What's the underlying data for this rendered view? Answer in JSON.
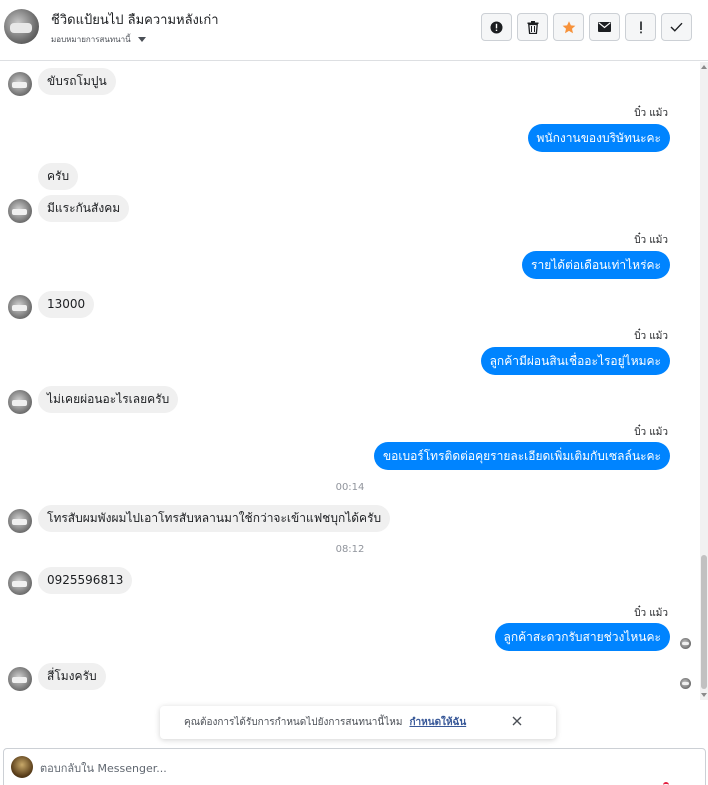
{
  "header": {
    "title": "ชีวิดแป้ยนไป ลืมความหลังเก่า",
    "subtitle": "มอบหมายการสนทนานี้"
  },
  "toolbar": {
    "icons": [
      "alert-circle-icon",
      "trash-icon",
      "star-icon",
      "envelope-icon",
      "exclamation-icon",
      "checkmark-icon"
    ],
    "star_color": "#f7923b"
  },
  "thread": {
    "sender_name": "บิ๋ว แม้ว",
    "messages": [
      {
        "dir": "in",
        "text": "ขับรถโมปูน"
      },
      {
        "dir": "out",
        "text": "พนักงานของบริษัทนะคะ"
      },
      {
        "dir": "in",
        "text": "ครับ"
      },
      {
        "dir": "in",
        "text": "มีแระกันสังคม"
      },
      {
        "dir": "out",
        "text": "รายได้ต่อเดือนเท่าไหร่คะ"
      },
      {
        "dir": "in",
        "text": "13000"
      },
      {
        "dir": "out",
        "text": "ลูกค้ามีผ่อนสินเชื่ออะไรอยู่ไหมคะ"
      },
      {
        "dir": "in",
        "text": "ไม่เคยผ่อนอะไรเลยครับ"
      },
      {
        "dir": "out",
        "text": "ขอเบอร์โทรติดต่อคุยรายละเอียดเพิ่มเติมกับเซลล์นะคะ"
      },
      {
        "dir": "in",
        "text": "โทรสับผมพังผมไปเอาโทรสับหลานมาใช้กว่าจะเข้าแฟชบุกได้ครับ"
      },
      {
        "dir": "in",
        "text": "0925596813"
      },
      {
        "dir": "out",
        "text": "ลูกค้าสะดวกรับสายช่วงไหนคะ"
      },
      {
        "dir": "in",
        "text": "สี่โมงครับ"
      }
    ],
    "timestamps": [
      "00:14",
      "08:12"
    ]
  },
  "toast": {
    "message": "คุณต้องการได้รับการกำหนดไปยังการสนทนานี้ไหม",
    "action": "กำหนดให้ฉัน"
  },
  "composer": {
    "placeholder": "ตอบกลับใน Messenger..."
  },
  "colors": {
    "outgoing_bubble": "#0084ff",
    "incoming_bubble": "#f0f0f0",
    "link": "#385898"
  }
}
